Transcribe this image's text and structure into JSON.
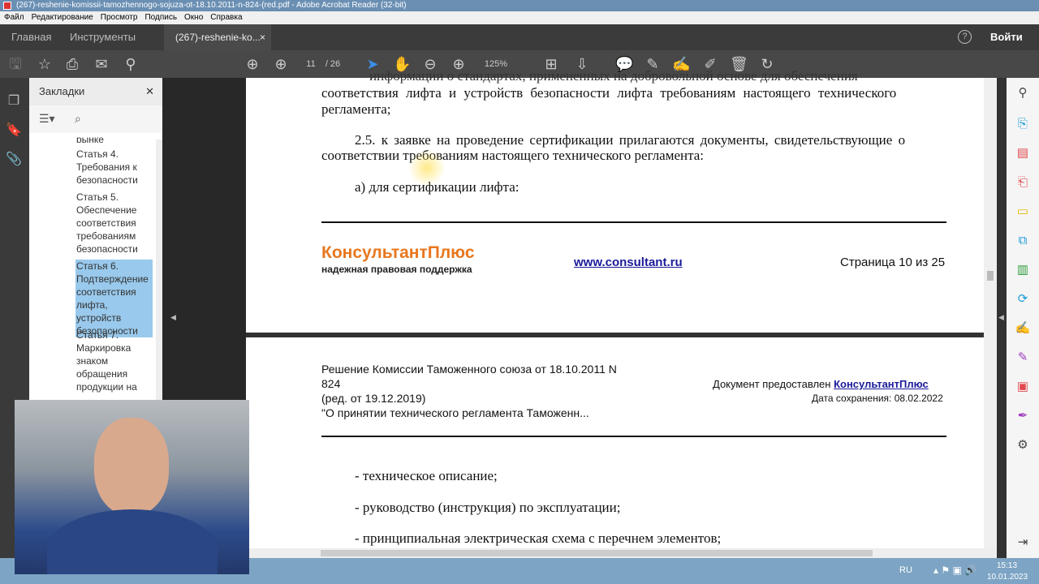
{
  "window": {
    "title": "(267)-reshenie-komissii-tamozhennogo-sojuza-ot-18.10.2011-n-824-(red.pdf - Adobe Acrobat Reader (32-bit)"
  },
  "menu": [
    "Файл",
    "Редактирование",
    "Просмотр",
    "Подпись",
    "Окно",
    "Справка"
  ],
  "tabs": {
    "home": "Главная",
    "tools": "Инструменты",
    "doc": "(267)-reshenie-ko...",
    "close": "×",
    "help": "?",
    "login": "Войти"
  },
  "toolbar": {
    "page_current": "11",
    "page_total": "/ 26",
    "zoom": "125%"
  },
  "bookmarks": {
    "title": "Закладки",
    "close": "✕",
    "items": [
      {
        "label": "рынке"
      },
      {
        "label": "Статья 4. Требования к безопасности"
      },
      {
        "label": "Статья 5. Обеспечение соответствия требованиям безопасности"
      },
      {
        "label": "Статья 6. Подтверждение соответствия лифта, устройств безопасности",
        "selected": true
      },
      {
        "label": "Статья 7. Маркировка знаком обращения продукции на"
      }
    ]
  },
  "page1": {
    "line0": "информации о стандартах, примененных на добровольной основе для обеспечения",
    "line1": "соответствия лифта и устройств безопасности лифта требованиям настоящего технического",
    "line2": "регламента;",
    "line3": "2.5. к заявке на проведение сертификации прилагаются документы, свидетельствующие о",
    "line4": "соответствии требованиям настоящего технического регламента:",
    "line5": "а) для сертификации лифта:",
    "brand": "КонсультантПлюс",
    "slogan": "надежная правовая поддержка",
    "url": "www.consultant.ru",
    "pageinfo": "Страница  10 из 25"
  },
  "page2": {
    "h1": "Решение Комиссии Таможенного союза от 18.10.2011 N",
    "h2": "824",
    "h3": "(ред. от 19.12.2019)",
    "h4": "\"О принятии технического регламента Таможенн...",
    "provided": "Документ предоставлен",
    "provider": "КонсультантПлюс",
    "saved": "Дата сохранения: 08.02.2022",
    "items": [
      "- техническое описание;",
      "- руководство (инструкция) по эксплуатации;",
      "- принципиальная электрическая схема с перечнем элементов;"
    ]
  },
  "taskbar": {
    "lang": "RU",
    "time": "15:13",
    "date": "10.01.2023"
  },
  "colors": {
    "accent": "#e8771e",
    "link": "#1a1a9a",
    "selection": "#99c9ec"
  }
}
